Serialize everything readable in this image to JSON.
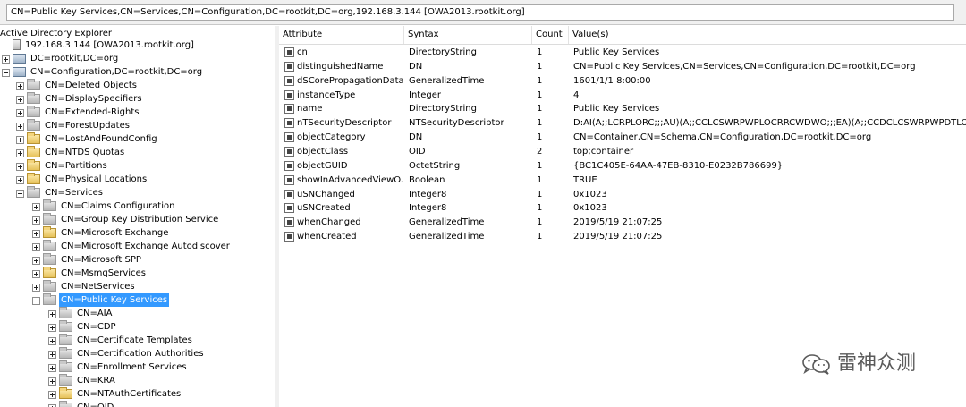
{
  "path_bar": {
    "text": "CN=Public Key Services,CN=Services,CN=Configuration,DC=rootkit,DC=org,192.168.3.144 [OWA2013.rootkit.org]"
  },
  "tree": {
    "title": "Active Directory Explorer",
    "nodes": [
      {
        "label": "192.168.3.144 [OWA2013.rootkit.org]",
        "icon": "server-icon",
        "expander": "none"
      },
      {
        "label": "DC=rootkit,DC=org",
        "icon": "domain-icon",
        "expander": "plus"
      },
      {
        "label": "CN=Configuration,DC=rootkit,DC=org",
        "icon": "domain-icon",
        "expander": "minus"
      },
      {
        "label": "CN=Deleted Objects",
        "icon": "container-icon",
        "expander": "plus"
      },
      {
        "label": "CN=DisplaySpecifiers",
        "icon": "container-icon",
        "expander": "plus"
      },
      {
        "label": "CN=Extended-Rights",
        "icon": "container-icon",
        "expander": "plus"
      },
      {
        "label": "CN=ForestUpdates",
        "icon": "container-icon",
        "expander": "plus"
      },
      {
        "label": "CN=LostAndFoundConfig",
        "icon": "folder-icon",
        "expander": "plus"
      },
      {
        "label": "CN=NTDS Quotas",
        "icon": "folder-icon",
        "expander": "plus"
      },
      {
        "label": "CN=Partitions",
        "icon": "folder-icon",
        "expander": "plus"
      },
      {
        "label": "CN=Physical Locations",
        "icon": "folder-icon",
        "expander": "plus"
      },
      {
        "label": "CN=Services",
        "icon": "container-icon",
        "expander": "minus"
      },
      {
        "label": "CN=Claims Configuration",
        "icon": "container-icon",
        "expander": "plus"
      },
      {
        "label": "CN=Group Key Distribution Service",
        "icon": "container-icon",
        "expander": "plus"
      },
      {
        "label": "CN=Microsoft Exchange",
        "icon": "folder-icon",
        "expander": "plus"
      },
      {
        "label": "CN=Microsoft Exchange Autodiscover",
        "icon": "container-icon",
        "expander": "plus"
      },
      {
        "label": "CN=Microsoft SPP",
        "icon": "container-icon",
        "expander": "plus"
      },
      {
        "label": "CN=MsmqServices",
        "icon": "folder-icon",
        "expander": "plus"
      },
      {
        "label": "CN=NetServices",
        "icon": "container-icon",
        "expander": "plus"
      },
      {
        "label": "CN=Public Key Services",
        "icon": "container-icon",
        "expander": "minus",
        "selected": true
      },
      {
        "label": "CN=AIA",
        "icon": "container-icon",
        "expander": "plus"
      },
      {
        "label": "CN=CDP",
        "icon": "container-icon",
        "expander": "plus"
      },
      {
        "label": "CN=Certificate Templates",
        "icon": "container-icon",
        "expander": "plus"
      },
      {
        "label": "CN=Certification Authorities",
        "icon": "container-icon",
        "expander": "plus"
      },
      {
        "label": "CN=Enrollment Services",
        "icon": "container-icon",
        "expander": "plus"
      },
      {
        "label": "CN=KRA",
        "icon": "container-icon",
        "expander": "plus"
      },
      {
        "label": "CN=NTAuthCertificates",
        "icon": "folder-icon",
        "expander": "plus"
      },
      {
        "label": "CN=OID",
        "icon": "container-icon",
        "expander": "plus"
      }
    ]
  },
  "table": {
    "headers": [
      "Attribute",
      "Syntax",
      "Count",
      "Value(s)"
    ],
    "rows": [
      {
        "attribute": "cn",
        "syntax": "DirectoryString",
        "count": "1",
        "value": "Public Key Services"
      },
      {
        "attribute": "distinguishedName",
        "syntax": "DN",
        "count": "1",
        "value": "CN=Public Key Services,CN=Services,CN=Configuration,DC=rootkit,DC=org"
      },
      {
        "attribute": "dSCorePropagationData",
        "syntax": "GeneralizedTime",
        "count": "1",
        "value": "1601/1/1 8:00:00"
      },
      {
        "attribute": "instanceType",
        "syntax": "Integer",
        "count": "1",
        "value": "4"
      },
      {
        "attribute": "name",
        "syntax": "DirectoryString",
        "count": "1",
        "value": "Public Key Services"
      },
      {
        "attribute": "nTSecurityDescriptor",
        "syntax": "NTSecurityDescriptor",
        "count": "1",
        "value": "D:AI(A;;LCRPLORC;;;AU)(A;;CCLCSWRPWPLOCRRCWDWO;;;EA)(A;;CCDCLCSWRPWPDTLOCRS"
      },
      {
        "attribute": "objectCategory",
        "syntax": "DN",
        "count": "1",
        "value": "CN=Container,CN=Schema,CN=Configuration,DC=rootkit,DC=org"
      },
      {
        "attribute": "objectClass",
        "syntax": "OID",
        "count": "2",
        "value": "top;container"
      },
      {
        "attribute": "objectGUID",
        "syntax": "OctetString",
        "count": "1",
        "value": "{BC1C405E-64AA-47EB-8310-E0232B786699}"
      },
      {
        "attribute": "showInAdvancedViewO...",
        "syntax": "Boolean",
        "count": "1",
        "value": "TRUE"
      },
      {
        "attribute": "uSNChanged",
        "syntax": "Integer8",
        "count": "1",
        "value": "0x1023"
      },
      {
        "attribute": "uSNCreated",
        "syntax": "Integer8",
        "count": "1",
        "value": "0x1023"
      },
      {
        "attribute": "whenChanged",
        "syntax": "GeneralizedTime",
        "count": "1",
        "value": "2019/5/19 21:07:25"
      },
      {
        "attribute": "whenCreated",
        "syntax": "GeneralizedTime",
        "count": "1",
        "value": "2019/5/19 21:07:25"
      }
    ]
  },
  "watermark": {
    "text": "雷神众测",
    "icon": "wechat-icon"
  },
  "colors": {
    "selection": "#3399ff",
    "folder": "#e6c25a",
    "watermark": "#5a5a5a"
  }
}
